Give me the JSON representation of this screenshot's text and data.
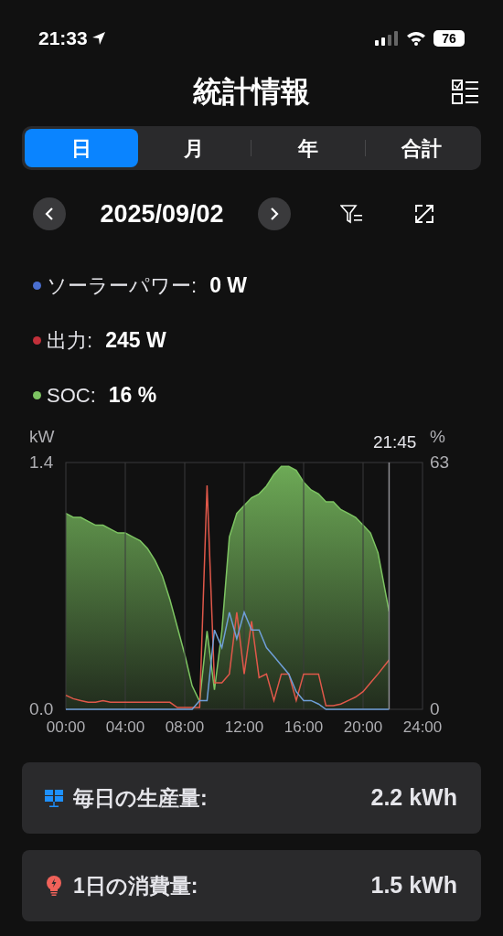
{
  "status_bar": {
    "time": "21:33",
    "battery": "76"
  },
  "title": "統計情報",
  "tabs": [
    {
      "label": "日",
      "selected": true
    },
    {
      "label": "月",
      "selected": false
    },
    {
      "label": "年",
      "selected": false
    },
    {
      "label": "合計",
      "selected": false
    }
  ],
  "date": "2025/09/02",
  "legend": [
    {
      "label": "ソーラーパワー:",
      "value": "0 W",
      "color": "#4a6fd0"
    },
    {
      "label": "出力:",
      "value": "245 W",
      "color": "#c2303a"
    },
    {
      "label": "SOC:",
      "value": "16 %",
      "color": "#7dc462"
    }
  ],
  "power_chart": {
    "chart_data": {
      "type": "line",
      "grid": true,
      "ylabel": "kW",
      "xlim": [
        0,
        24
      ],
      "ylim": [
        0,
        1.4
      ],
      "yticks": [
        {
          "value": 0,
          "label": "0.0"
        },
        {
          "value": 1.4,
          "label": "1.4"
        }
      ],
      "xticks": [
        {
          "value": 0,
          "label": "00:00"
        },
        {
          "value": 4,
          "label": "04:00"
        },
        {
          "value": 8,
          "label": "08:00"
        },
        {
          "value": 12,
          "label": "12:00"
        },
        {
          "value": 16,
          "label": "16:00"
        },
        {
          "value": 20,
          "label": "20:00"
        },
        {
          "value": 24,
          "label": "24:00"
        }
      ],
      "x": [
        0,
        0.5,
        1,
        1.5,
        2,
        2.5,
        3,
        3.5,
        4,
        4.5,
        5,
        5.5,
        6,
        6.5,
        7,
        7.5,
        8,
        8.5,
        9,
        9.5,
        10,
        10.5,
        11,
        11.5,
        12,
        12.5,
        13,
        13.5,
        14,
        14.5,
        15,
        15.5,
        16,
        16.5,
        17,
        17.5,
        18,
        18.5,
        19,
        19.5,
        20,
        20.5,
        21,
        21.75
      ],
      "series": [
        {
          "color": "#e0584a",
          "values": [
            0.08,
            0.06,
            0.05,
            0.04,
            0.04,
            0.05,
            0.04,
            0.04,
            0.04,
            0.04,
            0.04,
            0.04,
            0.04,
            0.04,
            0.04,
            0.01,
            0.01,
            0.01,
            0.01,
            1.27,
            0.15,
            0.15,
            0.2,
            0.55,
            0.2,
            0.5,
            0.18,
            0.2,
            0.05,
            0.2,
            0.2,
            0.05,
            0.2,
            0.2,
            0.2,
            0.02,
            0.02,
            0.03,
            0.05,
            0.07,
            0.1,
            0.15,
            0.2,
            0.28
          ]
        },
        {
          "color": "#6f9fd8",
          "values": [
            0,
            0,
            0,
            0,
            0,
            0,
            0,
            0,
            0,
            0,
            0,
            0,
            0,
            0,
            0,
            0,
            0,
            0,
            0.05,
            0.05,
            0.45,
            0.35,
            0.55,
            0.4,
            0.55,
            0.45,
            0.45,
            0.35,
            0.3,
            0.25,
            0.2,
            0.1,
            0.05,
            0.05,
            0.03,
            0,
            0,
            0,
            0,
            0,
            0,
            0,
            0,
            0
          ]
        }
      ],
      "annotations": [
        "21:45"
      ]
    }
  },
  "soc_chart": {
    "chart_data": {
      "type": "area",
      "ylabel": "%",
      "xlim": [
        0,
        24
      ],
      "ylim": [
        0,
        63
      ],
      "yticks": [
        {
          "value": 0,
          "label": "0"
        },
        {
          "value": 63,
          "label": "63"
        }
      ],
      "x": [
        0,
        0.5,
        1,
        1.5,
        2,
        2.5,
        3,
        3.5,
        4,
        4.5,
        5,
        5.5,
        6,
        6.5,
        7,
        7.5,
        8,
        8.5,
        9,
        9.5,
        10,
        10.5,
        11,
        11.5,
        12,
        12.5,
        13,
        13.5,
        14,
        14.5,
        15,
        15.5,
        16,
        16.5,
        17,
        17.5,
        18,
        18.5,
        19,
        19.5,
        20,
        20.5,
        21,
        21.75
      ],
      "series": [
        {
          "color": "#7dc462",
          "values": [
            50,
            49,
            49,
            48,
            47,
            47,
            46,
            45,
            45,
            44,
            43,
            41,
            38,
            34,
            28,
            21,
            14,
            6,
            2,
            20,
            5,
            20,
            44,
            50,
            52,
            54,
            55,
            57,
            60,
            62,
            62,
            61,
            58,
            56,
            55,
            53,
            53,
            51,
            50,
            49,
            47,
            45,
            40,
            25
          ]
        }
      ]
    }
  },
  "summary": [
    {
      "kind": "solar",
      "label": "毎日の生産量:",
      "value": "2.2 kWh"
    },
    {
      "kind": "bulb",
      "label": "1日の消費量:",
      "value": "1.5 kWh"
    }
  ]
}
